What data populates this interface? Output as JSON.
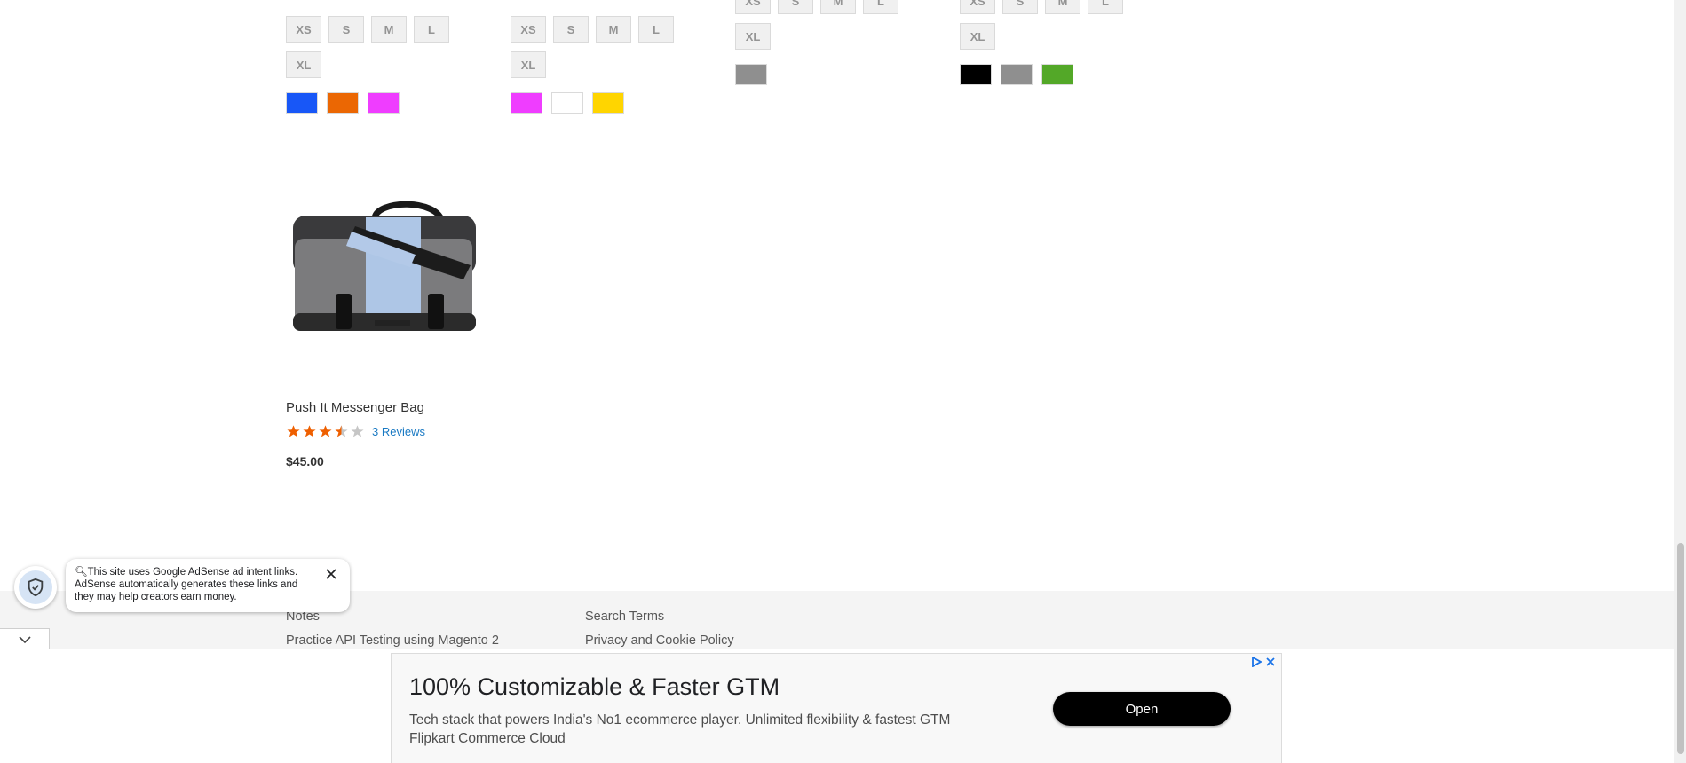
{
  "products": [
    {
      "sizes": [
        "XS",
        "S",
        "M",
        "L",
        "XL"
      ],
      "colors": [
        "#1857f7",
        "#eb6703",
        "#ef3dff"
      ]
    },
    {
      "sizes": [
        "XS",
        "S",
        "M",
        "L",
        "XL"
      ],
      "colors": [
        "#ef3dff",
        "#ffffff",
        "#ffd500"
      ]
    },
    {
      "sizes": [
        "XS",
        "S",
        "M",
        "L",
        "XL"
      ],
      "colors": [
        "#8f8f8f"
      ]
    },
    {
      "sizes": [
        "XS",
        "S",
        "M",
        "L",
        "XL"
      ],
      "colors": [
        "#000000",
        "#8f8f8f",
        "#53a828"
      ]
    }
  ],
  "bag": {
    "name": "Push It Messenger Bag",
    "rating_stars": 3.5,
    "rating_max": 5,
    "reviews": "3 Reviews",
    "price": "$45.00"
  },
  "footer": {
    "links_col1": [
      "Notes",
      "Practice API Testing using Magento 2"
    ],
    "links_col2": [
      "Search Terms",
      "Privacy and Cookie Policy"
    ]
  },
  "adsense_notice": {
    "text": "This site uses Google AdSense ad intent links. AdSense automatically generates these links and they may help creators earn money."
  },
  "ad": {
    "headline": "100% Customizable & Faster GTM",
    "description": "Tech stack that powers India's No1 ecommerce player. Unlimited flexibility & fastest GTM",
    "advertiser": "Flipkart Commerce Cloud",
    "cta": "Open"
  },
  "colors": {
    "star_filled": "#ee5f00",
    "star_empty": "#c6c6c6",
    "link": "#1979c3",
    "footer_bg": "#f4f4f4"
  }
}
